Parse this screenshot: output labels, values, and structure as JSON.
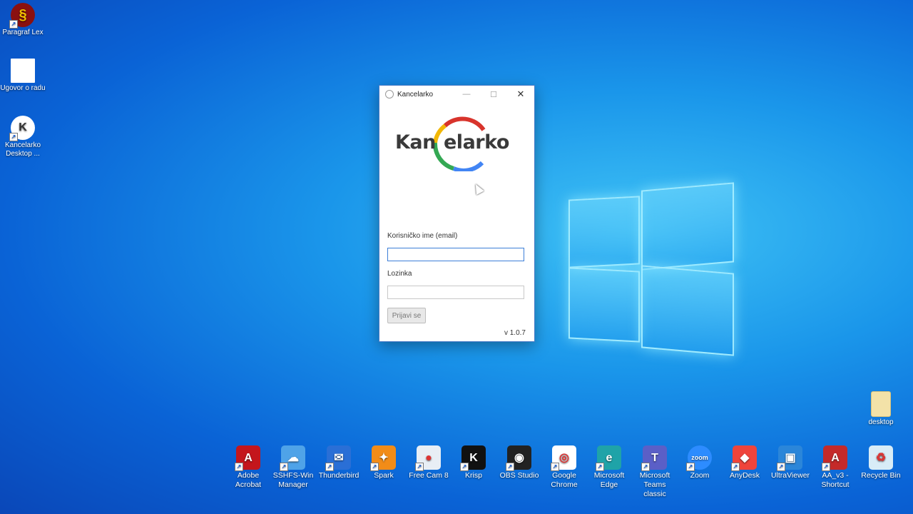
{
  "desktop_icons": [
    {
      "label": "Paragraf Lex",
      "icon": "paragraf-lex-icon"
    },
    {
      "label": "Ugovor o radu",
      "icon": "document-icon"
    },
    {
      "label": "Kancelarko Desktop ...",
      "icon": "kancelarko-icon"
    }
  ],
  "bottom_icons": [
    {
      "label": "Adobe Acrobat",
      "icon": "adobe-acrobat-icon",
      "color": "#c4161c",
      "glyph": "A"
    },
    {
      "label": "SSHFS-Win Manager",
      "icon": "sshfs-icon",
      "color": "#4fa3e8",
      "glyph": "☁"
    },
    {
      "label": "Thunderbird",
      "icon": "thunderbird-icon",
      "color": "#2a6fd6",
      "glyph": "✉"
    },
    {
      "label": "Spark",
      "icon": "spark-icon",
      "color": "#f28c18",
      "glyph": "✦"
    },
    {
      "label": "Free Cam 8",
      "icon": "free-cam-icon",
      "color": "#e8eef5",
      "glyph": "●"
    },
    {
      "label": "Krisp",
      "icon": "krisp-icon",
      "color": "#111111",
      "glyph": "K"
    },
    {
      "label": "OBS Studio",
      "icon": "obs-studio-icon",
      "color": "#222222",
      "glyph": "◉"
    },
    {
      "label": "Google Chrome",
      "icon": "chrome-icon",
      "color": "#ffffff",
      "glyph": "◎"
    },
    {
      "label": "Microsoft Edge",
      "icon": "edge-icon",
      "color": "#1fa3a8",
      "glyph": "e"
    },
    {
      "label": "Microsoft Teams classic",
      "icon": "teams-icon",
      "color": "#5b5fc7",
      "glyph": "T"
    },
    {
      "label": "Zoom",
      "icon": "zoom-icon",
      "color": "#2d8cff",
      "glyph": "zoom"
    },
    {
      "label": "AnyDesk",
      "icon": "anydesk-icon",
      "color": "#ef443b",
      "glyph": "◆"
    },
    {
      "label": "UltraViewer",
      "icon": "ultraviewer-icon",
      "color": "#2b86d9",
      "glyph": "▣"
    },
    {
      "label": "AA_v3 - Shortcut",
      "icon": "ammyy-admin-icon",
      "color": "#c42a2a",
      "glyph": "A"
    },
    {
      "label": "Recycle Bin",
      "icon": "recycle-bin-icon",
      "color": "#d8ecf7",
      "glyph": "♻"
    }
  ],
  "desktop_folder": {
    "label": "desktop",
    "icon": "folder-icon"
  },
  "window": {
    "title": "Kancelarko",
    "minimize": "—",
    "maximize": "☐",
    "close": "✕",
    "brand_left": "Kan",
    "brand_right": "elarko",
    "username_label": "Korisničko ime (email)",
    "username_value": "",
    "password_label": "Lozinka",
    "password_value": "",
    "login_button": "Prijavi se",
    "version": "v 1.0.7"
  }
}
